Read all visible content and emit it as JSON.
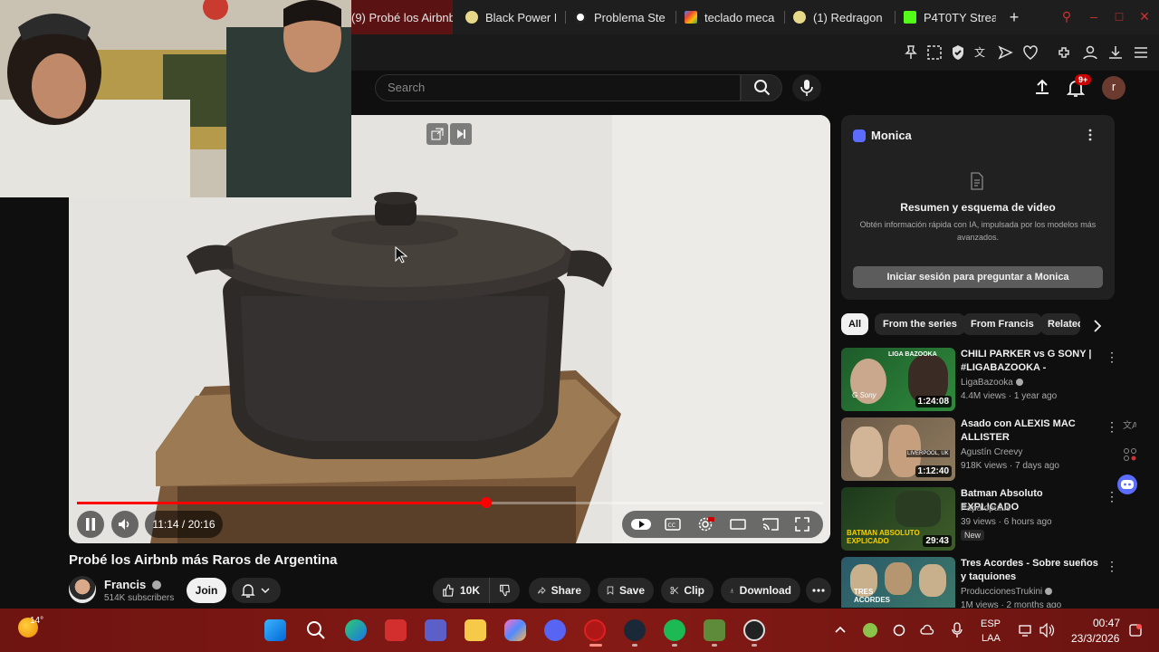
{
  "browser": {
    "tabs": [
      {
        "title": "(9) Probé los Airbnb",
        "active": true
      },
      {
        "title": "Black Power F"
      },
      {
        "title": "Problema Ste"
      },
      {
        "title": "teclado meca"
      },
      {
        "title": "(1) Redragon"
      },
      {
        "title": "P4T0TY Strea"
      }
    ],
    "new_tab": "+"
  },
  "youtube": {
    "search_placeholder": "Search",
    "notifications_badge": "9+",
    "avatar_letter": "r",
    "video": {
      "title": "Probé los Airbnb más Raros de Argentina",
      "time_current": "11:14",
      "time_sep": " / ",
      "time_total": "20:16",
      "progress": 0.549
    },
    "channel": {
      "name": "Francis",
      "subscribers": "514K subscribers",
      "join_label": "Join"
    },
    "actions": {
      "likes": "10K",
      "share": "Share",
      "save": "Save",
      "clip": "Clip",
      "download": "Download"
    },
    "chips": [
      "All",
      "From the series",
      "From Francis",
      "Related"
    ],
    "recommendations": [
      {
        "title": "CHILI PARKER vs G SONY | #LIGABAZOOKA - MOVISTAR ...",
        "channel": "LigaBazooka",
        "meta": "4.4M views · 1 year ago",
        "duration": "1:24:08",
        "verified": true
      },
      {
        "title": "Asado con ALEXIS MAC ALLISTER",
        "channel": "Agustín Creevy",
        "meta": "918K views · 7 days ago",
        "duration": "1:12:40"
      },
      {
        "title": "Batman Absoluto EXPLICADO",
        "channel": "Papalopulus",
        "meta": "39 views · 6 hours ago",
        "duration": "29:43",
        "badge": "New"
      },
      {
        "title": "Tres Acordes - Sobre sueños y taquiones",
        "channel": "ProduccionesTrukini",
        "meta": "1M views · 2 months ago",
        "verified": true
      }
    ],
    "thumb_texts": [
      "LIGA BAZOOKA",
      "G Sony",
      "LIVERPOOL, UK",
      "BATMAN ABSOLUTO EXPLICADO",
      "TRES ACORDES"
    ]
  },
  "monica": {
    "name": "Monica",
    "heading": "Resumen y esquema de video",
    "description": "Obtén información rápida con IA, impulsada por los modelos más avanzados.",
    "cta": "Iniciar sesión para preguntar a Monica"
  },
  "taskbar": {
    "weather": "14°",
    "language": "ESP",
    "layout": "LAA",
    "time": "00:47",
    "date": "23/3/2026"
  }
}
